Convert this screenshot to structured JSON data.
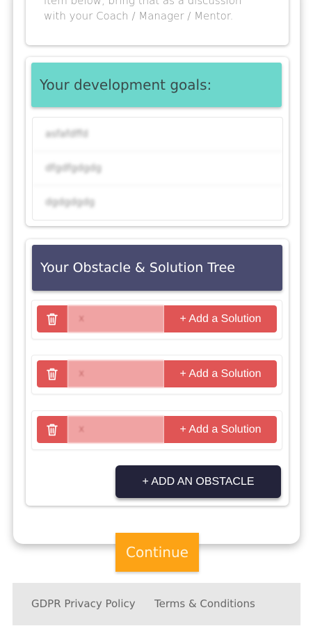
{
  "intro": {
    "line1": "item below, bring that as a discussion",
    "line2": "with your Coach / Manager / Mentor."
  },
  "goals": {
    "title": "Your development goals:",
    "items": [
      "asfafdffd",
      "dfgdfgdgdg",
      "dgdgdgdg"
    ]
  },
  "obstacle_tree": {
    "title": "Your Obstacle & Solution Tree",
    "obstacles": [
      {
        "value": "x",
        "add_solution_label": "+ Add a Solution"
      },
      {
        "value": "x",
        "add_solution_label": "+ Add a Solution"
      },
      {
        "value": "x",
        "add_solution_label": "+ Add a Solution"
      }
    ],
    "add_obstacle_label": "+ ADD AN OBSTACLE"
  },
  "continue_label": "Continue",
  "footer": {
    "privacy_label": "GDPR Privacy Policy",
    "terms_label": "Terms & Conditions"
  },
  "colors": {
    "goals_header": "#6dd7cc",
    "tree_header": "#494b6f",
    "obstacle_red": "#e05555",
    "obstacle_input": "#f0a3a3",
    "add_obstacle": "#23233a",
    "continue": "#fda315",
    "footer_bg": "#e7e7e7"
  },
  "icons": {
    "delete_obstacle": "trash-icon"
  }
}
